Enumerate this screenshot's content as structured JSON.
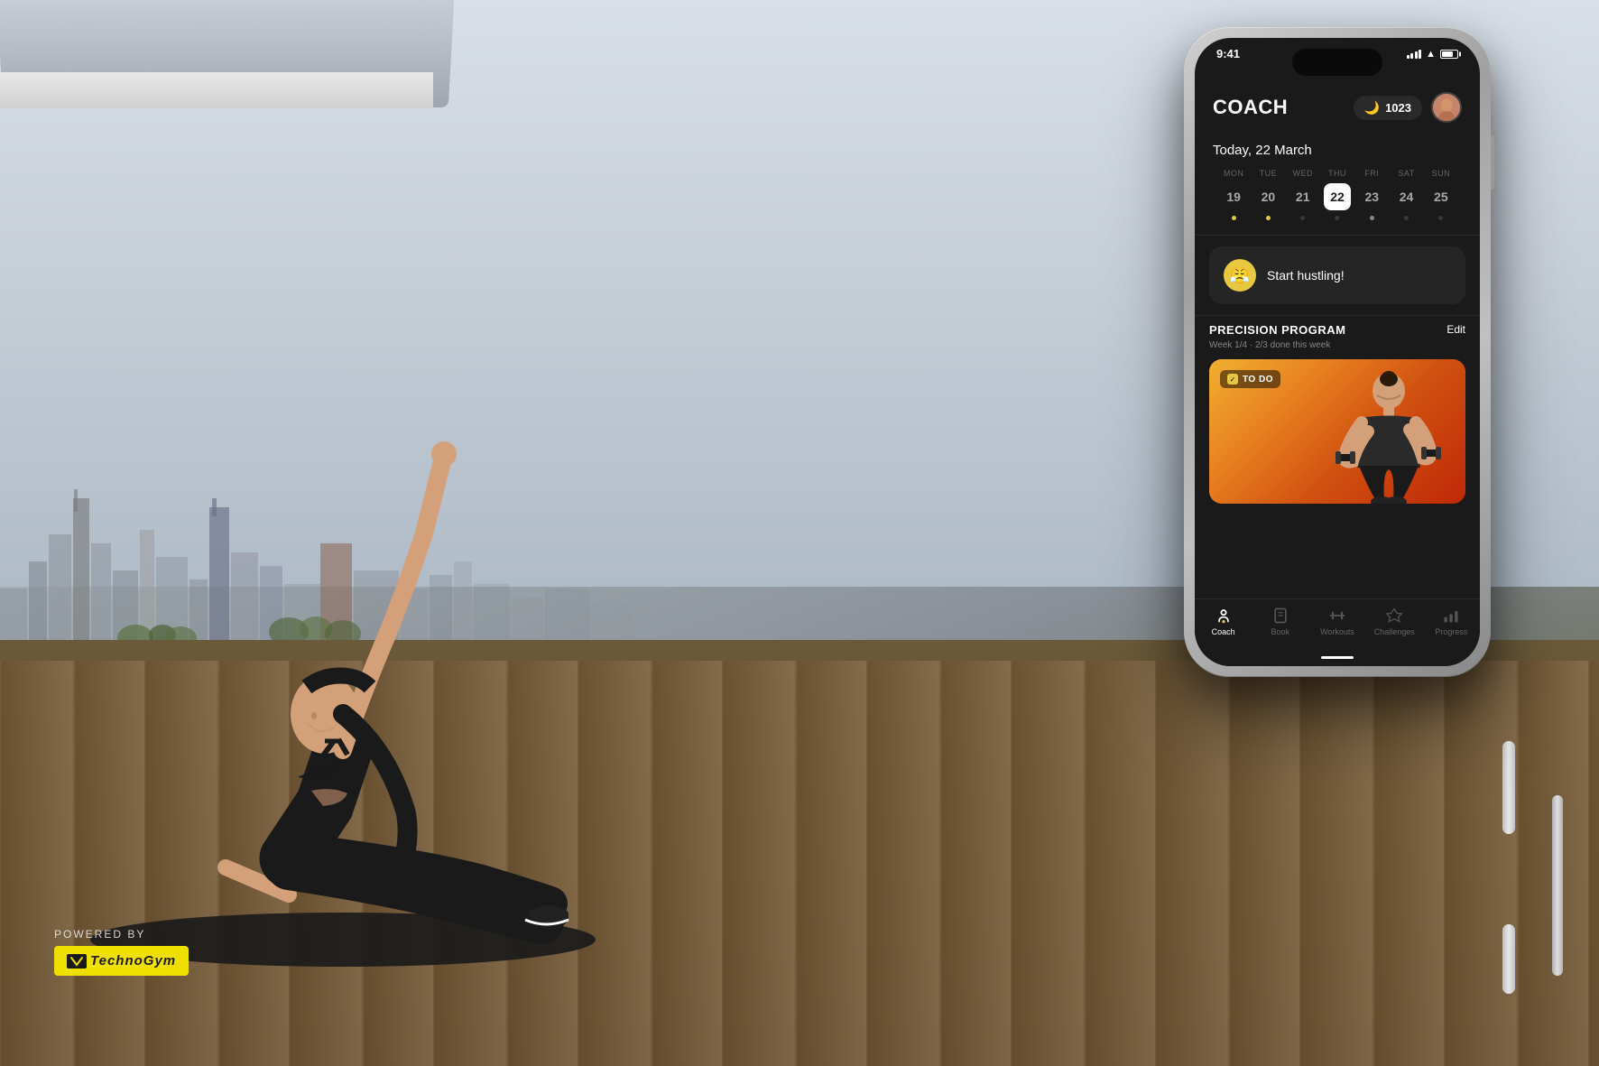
{
  "background": {
    "sky_color_top": "#d8dfe8",
    "sky_color_bottom": "#b0bcc8",
    "floor_color": "#6b5a3a"
  },
  "powered_by": {
    "label": "POWERED BY",
    "brand": "TechnoGym"
  },
  "phone": {
    "status_bar": {
      "time": "9:41",
      "signal": "full",
      "wifi": true,
      "battery": "75%"
    },
    "header": {
      "title": "COACH",
      "points": "1023",
      "moon_icon": "🌙"
    },
    "date_section": {
      "label": "Today, 22 March",
      "week": [
        {
          "day": "MON",
          "number": "19",
          "dot": "yellow",
          "active": false
        },
        {
          "day": "TUE",
          "number": "20",
          "dot": "yellow",
          "active": false
        },
        {
          "day": "WED",
          "number": "21",
          "dot": "empty",
          "active": false
        },
        {
          "day": "THU",
          "number": "22",
          "dot": "empty",
          "active": true
        },
        {
          "day": "FRI",
          "number": "23",
          "dot": "white",
          "active": false
        },
        {
          "day": "SAT",
          "number": "24",
          "dot": "empty",
          "active": false
        },
        {
          "day": "SUN",
          "number": "25",
          "dot": "empty",
          "active": false
        }
      ]
    },
    "message": {
      "text": "Start hustling!",
      "emoji": "😤"
    },
    "program": {
      "title": "PRECISION PROGRAM",
      "subtitle": "Week 1/4 · 2/3 done this week",
      "edit_label": "Edit",
      "card": {
        "badge": "TO DO",
        "status_color": "#e8c840"
      }
    },
    "bottom_nav": [
      {
        "icon": "coach",
        "label": "Coach",
        "active": true
      },
      {
        "icon": "book",
        "label": "Book",
        "active": false
      },
      {
        "icon": "workouts",
        "label": "Workouts",
        "active": false
      },
      {
        "icon": "challenges",
        "label": "Challenges",
        "active": false
      },
      {
        "icon": "progress",
        "label": "Progress",
        "active": false
      }
    ]
  }
}
